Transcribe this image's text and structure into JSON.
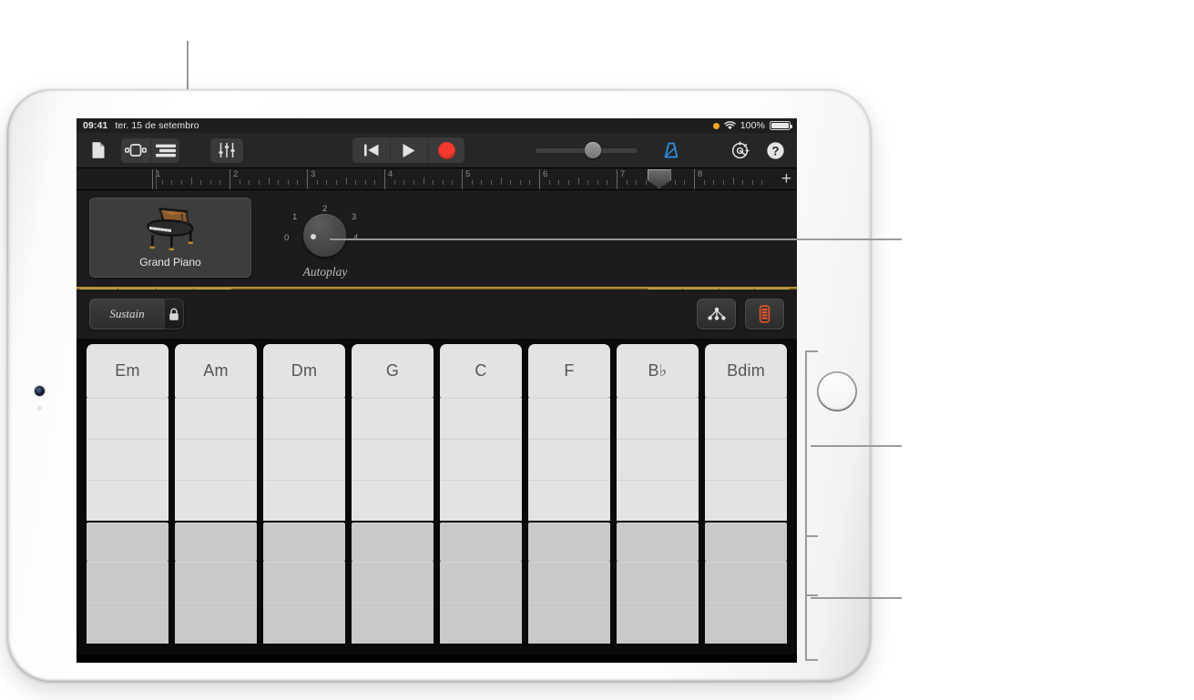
{
  "device": {
    "name": "ipad-white",
    "home_button": "home-button",
    "camera": "front-camera"
  },
  "statusbar": {
    "time": "09:41",
    "date": "ter. 15 de setembro",
    "battery_percent": "100%",
    "wifi_icon": "wifi-icon",
    "orange_dot_icon": "recording-indicator-dot",
    "battery_icon": "battery-full-icon"
  },
  "toolbar": {
    "left_buttons": [
      {
        "name": "my-songs-button",
        "icon": "document-icon"
      },
      {
        "name": "view-toggle-button",
        "icon": "track-view-icon"
      },
      {
        "name": "tracks-view-button",
        "icon": "tracks-list-icon"
      },
      {
        "name": "mixer-button",
        "icon": "faders-icon"
      }
    ],
    "transport": [
      {
        "name": "rewind-button",
        "icon": "rewind-icon"
      },
      {
        "name": "play-button",
        "icon": "play-icon"
      },
      {
        "name": "record-button",
        "icon": "record-icon"
      }
    ],
    "master_slider": {
      "name": "master-volume-slider",
      "value_percent": 48
    },
    "metronome": {
      "name": "metronome-button",
      "icon": "metronome-icon",
      "accent_color": "#2f8fe8"
    },
    "right_buttons": [
      {
        "name": "settings-button",
        "icon": "gear-icon"
      },
      {
        "name": "help-button",
        "icon": "question-mark-icon"
      }
    ]
  },
  "ruler": {
    "bars": [
      "1",
      "2",
      "3",
      "4",
      "5",
      "6",
      "7",
      "8"
    ],
    "loop_marker": {
      "name": "section-end-marker",
      "bar_position": 7.55
    },
    "add_button_label": "+",
    "playhead_bar": 1.05
  },
  "track": {
    "instrument": {
      "name": "grand-piano-track",
      "label": "Grand Piano",
      "icon": "grand-piano-icon"
    },
    "autoplay": {
      "label": "Autoplay",
      "ticks": [
        "0",
        "1",
        "2",
        "3",
        "4"
      ],
      "value": "0",
      "knob_name": "autoplay-knob"
    }
  },
  "controls": {
    "sustain_label": "Sustain",
    "lock_icon": "lock-icon",
    "chords_button_icon": "chords-notes-icon",
    "keyboard_button_icon": "keyboard-switch-icon"
  },
  "chords": {
    "names": [
      "Em",
      "Am",
      "Dm",
      "G",
      "C",
      "F",
      "B♭",
      "Bdim"
    ],
    "rows_light": 4,
    "rows_dark": 3,
    "colors": {
      "light": "#e2e3e5",
      "dark": "#c9c9c9",
      "text": "#555555"
    }
  },
  "callouts": {
    "top_pointer": "points-to-instrument-icon",
    "right_pointer_knob": "points-to-autoplay-knob",
    "bracket_upper": "points-to-chord-upper-rows",
    "bracket_lower": "points-to-chord-lower-rows"
  }
}
